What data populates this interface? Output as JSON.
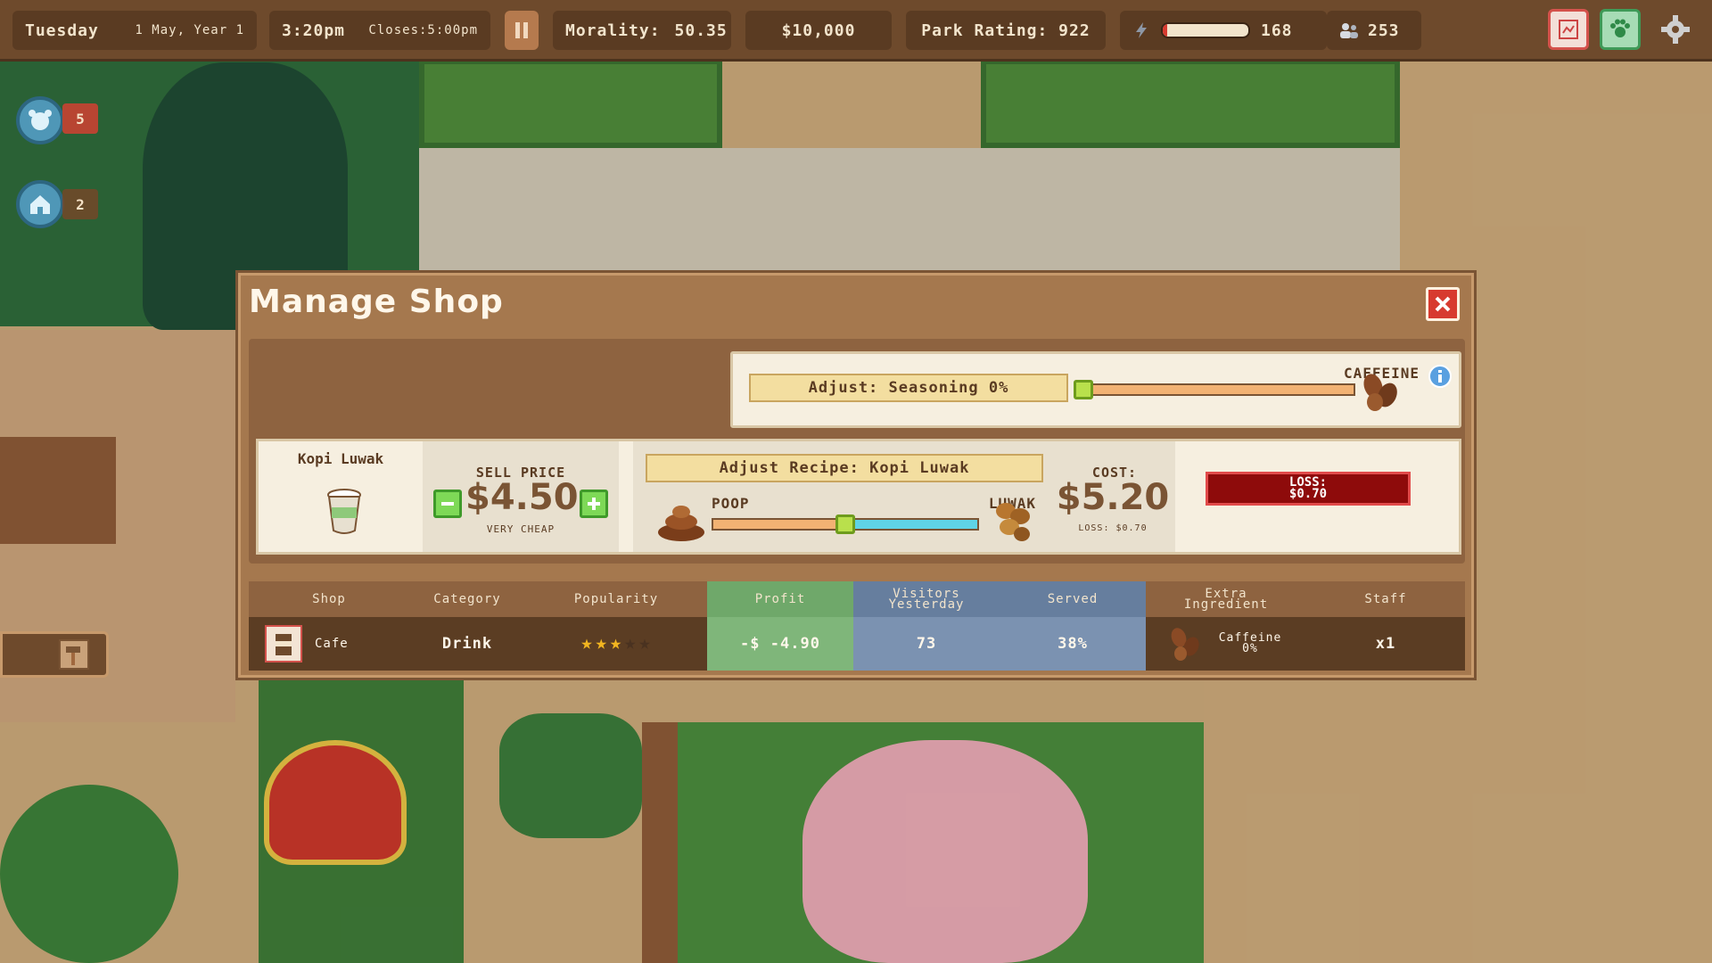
{
  "topbar": {
    "day": "Tuesday",
    "date": "1 May, Year 1",
    "time": "3:20pm",
    "closes": "Closes:5:00pm",
    "morality_label": "Morality:",
    "morality_value": "50.35",
    "money": "$10,000",
    "park_rating": "Park Rating: 922",
    "energy_progress": 0.05,
    "energy_count": "168",
    "visitors": "253"
  },
  "side": {
    "animals_count": "5",
    "habitats_count": "2"
  },
  "modal": {
    "title": "Manage Shop",
    "seasoning": {
      "label": "Adjust: Seasoning 0%",
      "right_label": "CAFFEINE",
      "value": 0
    },
    "product": {
      "name": "Kopi Luwak",
      "sell_price_label": "SELL PRICE",
      "sell_price": "$4.50",
      "price_note": "VERY CHEAP",
      "recipe_label": "Adjust Recipe: Kopi Luwak",
      "left_ingredient": "POOP",
      "right_ingredient": "LUWAK",
      "recipe_value": 0.5,
      "cost_label": "COST:",
      "cost": "$5.20",
      "loss_small": "LOSS: $0.70",
      "loss_label": "LOSS:",
      "loss_value": "$0.70"
    },
    "table": {
      "headers": [
        "Shop",
        "Category",
        "Popularity",
        "Profit",
        "Visitors Yesterday",
        "Served",
        "Extra Ingredient",
        "Staff"
      ],
      "row": {
        "shop": "Cafe",
        "category": "Drink",
        "popularity": 3,
        "popularity_max": 5,
        "profit": "-$ -4.90",
        "visitors": "73",
        "served": "38%",
        "extra_ingredient": "Caffeine 0%",
        "staff": "x1"
      }
    }
  },
  "colors": {
    "accent_red": "#d73a2f",
    "profit_green": "#6fa86a",
    "visitors_blue": "#7b92b1",
    "loss_red": "#8e0b0b"
  }
}
